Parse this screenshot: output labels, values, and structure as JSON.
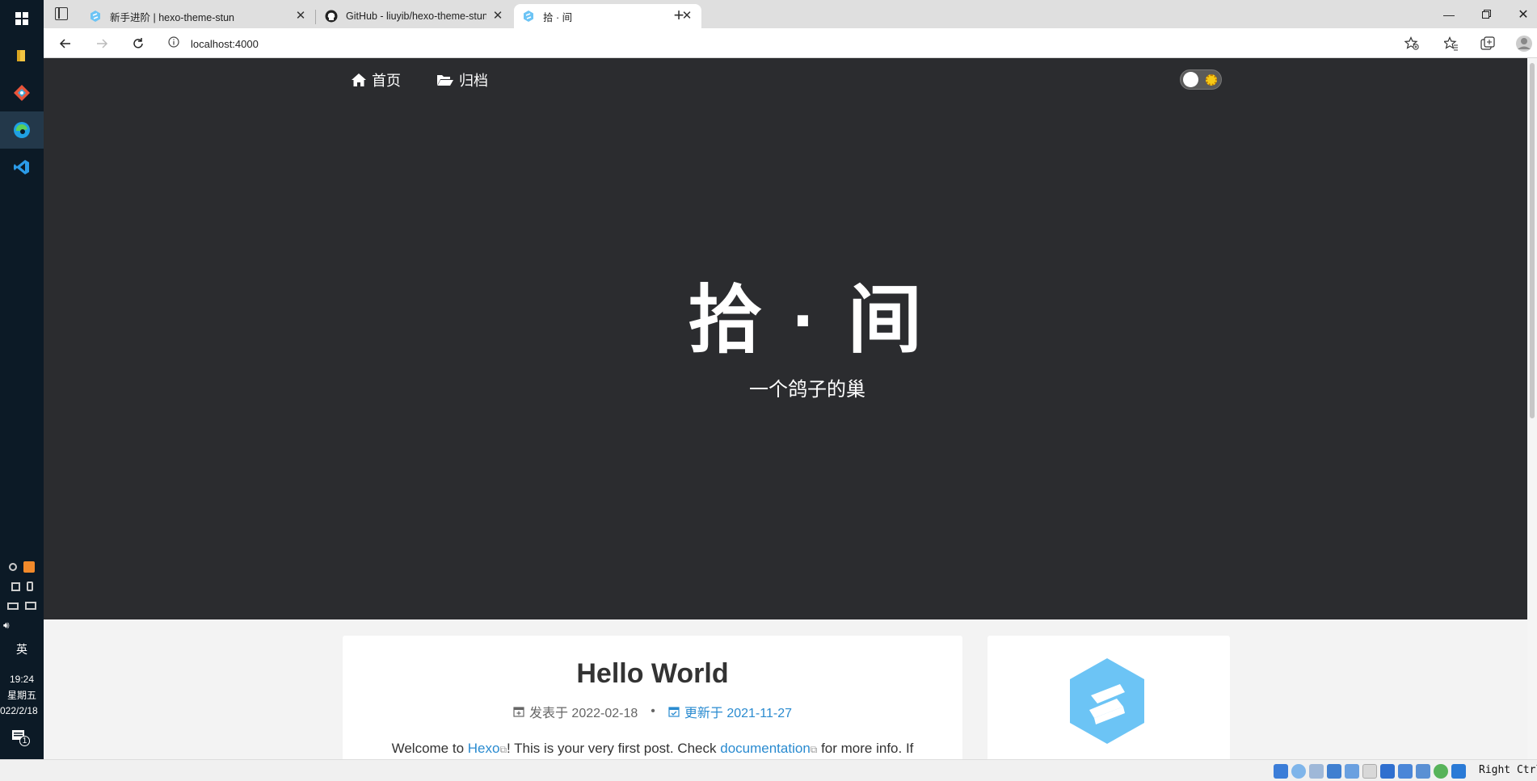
{
  "taskbar": {
    "apps": [
      "start-icon",
      "file-explorer-icon",
      "git-icon",
      "edge-icon",
      "vscode-icon"
    ],
    "ime": "英",
    "time": "19:24",
    "weekday": "星期五",
    "date": "022/2/18",
    "notification_count": "1"
  },
  "browser": {
    "tabs": [
      {
        "title": "新手进阶 | hexo-theme-stun",
        "favicon": "stun-icon"
      },
      {
        "title": "GitHub - liuyib/hexo-theme-stun",
        "favicon": "github-icon"
      },
      {
        "title": "拾 · 间",
        "favicon": "stun-icon"
      }
    ],
    "active_tab": 2,
    "url": "localhost:4000"
  },
  "page": {
    "nav": [
      {
        "label": "首页",
        "icon": "home-icon"
      },
      {
        "label": "归档",
        "icon": "folder-open-icon"
      }
    ],
    "site_title": "拾 · 间",
    "site_subtitle": "一个鸽子的巢",
    "post": {
      "title": "Hello World",
      "published_label": "发表于 2022-02-18",
      "updated_label": "更新于 2021-11-27",
      "excerpt_pre": "Welcome to ",
      "excerpt_link1": "Hexo",
      "excerpt_mid": "! This is your very first post. Check ",
      "excerpt_link2": "documentation",
      "excerpt_post": " for more info. If"
    }
  },
  "vbox": {
    "host_key": "Right Ctrl"
  },
  "colors": {
    "hero_bg": "#2b2c2f",
    "link": "#2a8bd0",
    "stun_logo": "#6cc4f5"
  }
}
